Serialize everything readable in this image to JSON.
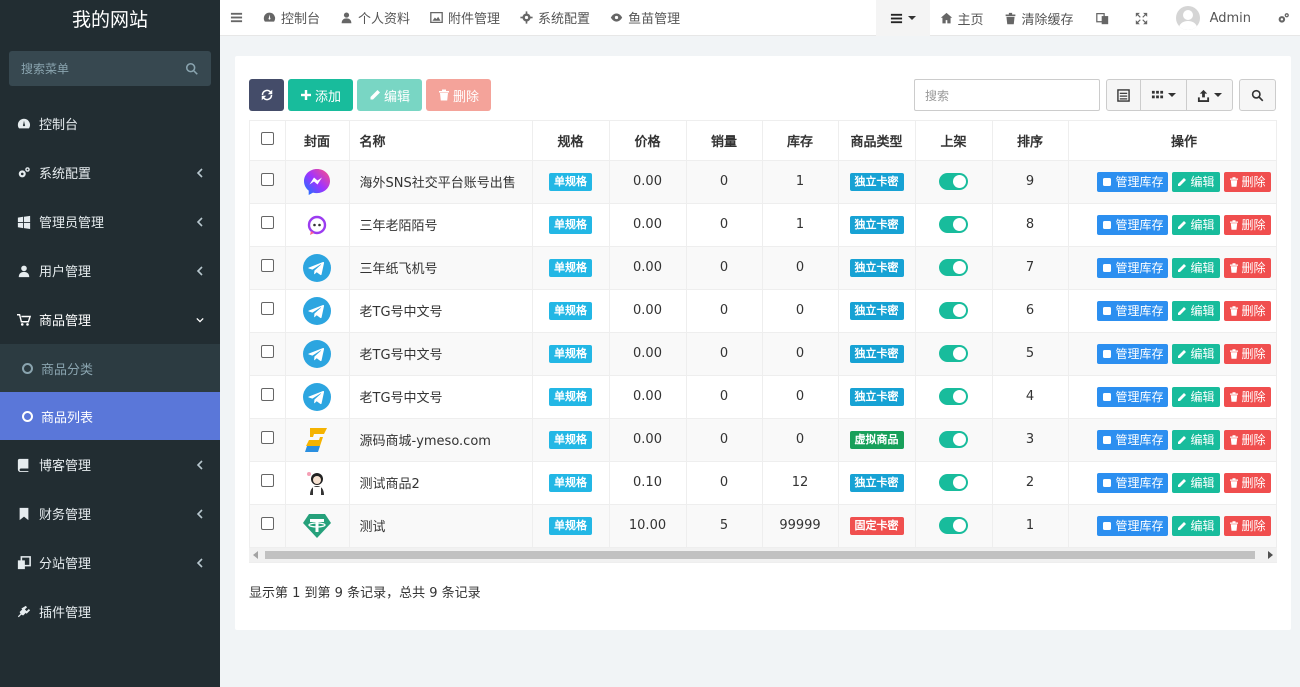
{
  "sidebar": {
    "brand": "我的网站",
    "search_placeholder": "搜索菜单",
    "items": [
      {
        "label": "控制台",
        "icon": "dashboard-icon"
      },
      {
        "label": "系统配置",
        "icon": "cogs-icon"
      },
      {
        "label": "管理员管理",
        "icon": "windows-icon"
      },
      {
        "label": "用户管理",
        "icon": "user-icon"
      },
      {
        "label": "商品管理",
        "icon": "cart-icon"
      },
      {
        "label": "博客管理",
        "icon": "book-icon"
      },
      {
        "label": "财务管理",
        "icon": "bookmark-icon"
      },
      {
        "label": "分站管理",
        "icon": "clone-icon"
      },
      {
        "label": "插件管理",
        "icon": "plug-icon"
      }
    ],
    "subitems": [
      {
        "label": "商品分类"
      },
      {
        "label": "商品列表"
      }
    ]
  },
  "topbar": {
    "tabs": [
      {
        "label": "控制台"
      },
      {
        "label": "个人资料"
      },
      {
        "label": "附件管理"
      },
      {
        "label": "系统配置"
      },
      {
        "label": "鱼苗管理"
      }
    ],
    "home": "主页",
    "clear_cache": "清除缓存",
    "user": "Admin"
  },
  "toolbar": {
    "add": "添加",
    "edit": "编辑",
    "delete": "删除",
    "search_placeholder": "搜索"
  },
  "table": {
    "headers": [
      "封面",
      "名称",
      "规格",
      "价格",
      "销量",
      "库存",
      "商品类型",
      "上架",
      "排序",
      "操作"
    ],
    "op_labels": {
      "stock": "管理库存",
      "edit": "编辑",
      "delete": "删除"
    },
    "rows": [
      {
        "cover": "messenger-icon",
        "name": "海外SNS社交平台账号出售",
        "spec": "单规格",
        "price": "0.00",
        "sales": "0",
        "stock": "1",
        "type": "独立卡密",
        "type_color": "#17a2d4",
        "on_sale": true,
        "sort": "9"
      },
      {
        "cover": "chat-bubble-icon",
        "name": "三年老陌陌号",
        "spec": "单规格",
        "price": "0.00",
        "sales": "0",
        "stock": "1",
        "type": "独立卡密",
        "type_color": "#17a2d4",
        "on_sale": true,
        "sort": "8"
      },
      {
        "cover": "telegram-icon",
        "name": "三年纸飞机号",
        "spec": "单规格",
        "price": "0.00",
        "sales": "0",
        "stock": "0",
        "type": "独立卡密",
        "type_color": "#17a2d4",
        "on_sale": true,
        "sort": "7"
      },
      {
        "cover": "telegram-icon",
        "name": "老TG号中文号",
        "spec": "单规格",
        "price": "0.00",
        "sales": "0",
        "stock": "0",
        "type": "独立卡密",
        "type_color": "#17a2d4",
        "on_sale": true,
        "sort": "6"
      },
      {
        "cover": "telegram-icon",
        "name": "老TG号中文号",
        "spec": "单规格",
        "price": "0.00",
        "sales": "0",
        "stock": "0",
        "type": "独立卡密",
        "type_color": "#17a2d4",
        "on_sale": true,
        "sort": "5"
      },
      {
        "cover": "telegram-icon",
        "name": "老TG号中文号",
        "spec": "单规格",
        "price": "0.00",
        "sales": "0",
        "stock": "0",
        "type": "独立卡密",
        "type_color": "#17a2d4",
        "on_sale": true,
        "sort": "4"
      },
      {
        "cover": "s-logo-icon",
        "name": "源码商城-ymeso.com",
        "spec": "单规格",
        "price": "0.00",
        "sales": "0",
        "stock": "0",
        "type": "虚拟商品",
        "type_color": "#18a05a",
        "on_sale": true,
        "sort": "3"
      },
      {
        "cover": "cartoon-figure-icon",
        "name": "测试商品2",
        "spec": "单规格",
        "price": "0.10",
        "sales": "0",
        "stock": "12",
        "type": "独立卡密",
        "type_color": "#17a2d4",
        "on_sale": true,
        "sort": "2"
      },
      {
        "cover": "tether-icon",
        "name": "测试",
        "spec": "单规格",
        "price": "10.00",
        "sales": "5",
        "stock": "99999",
        "type": "固定卡密",
        "type_color": "#f0504f",
        "on_sale": true,
        "sort": "1"
      }
    ]
  },
  "pager": {
    "info": "显示第 1 到第 9 条记录，总共 9 条记录"
  }
}
